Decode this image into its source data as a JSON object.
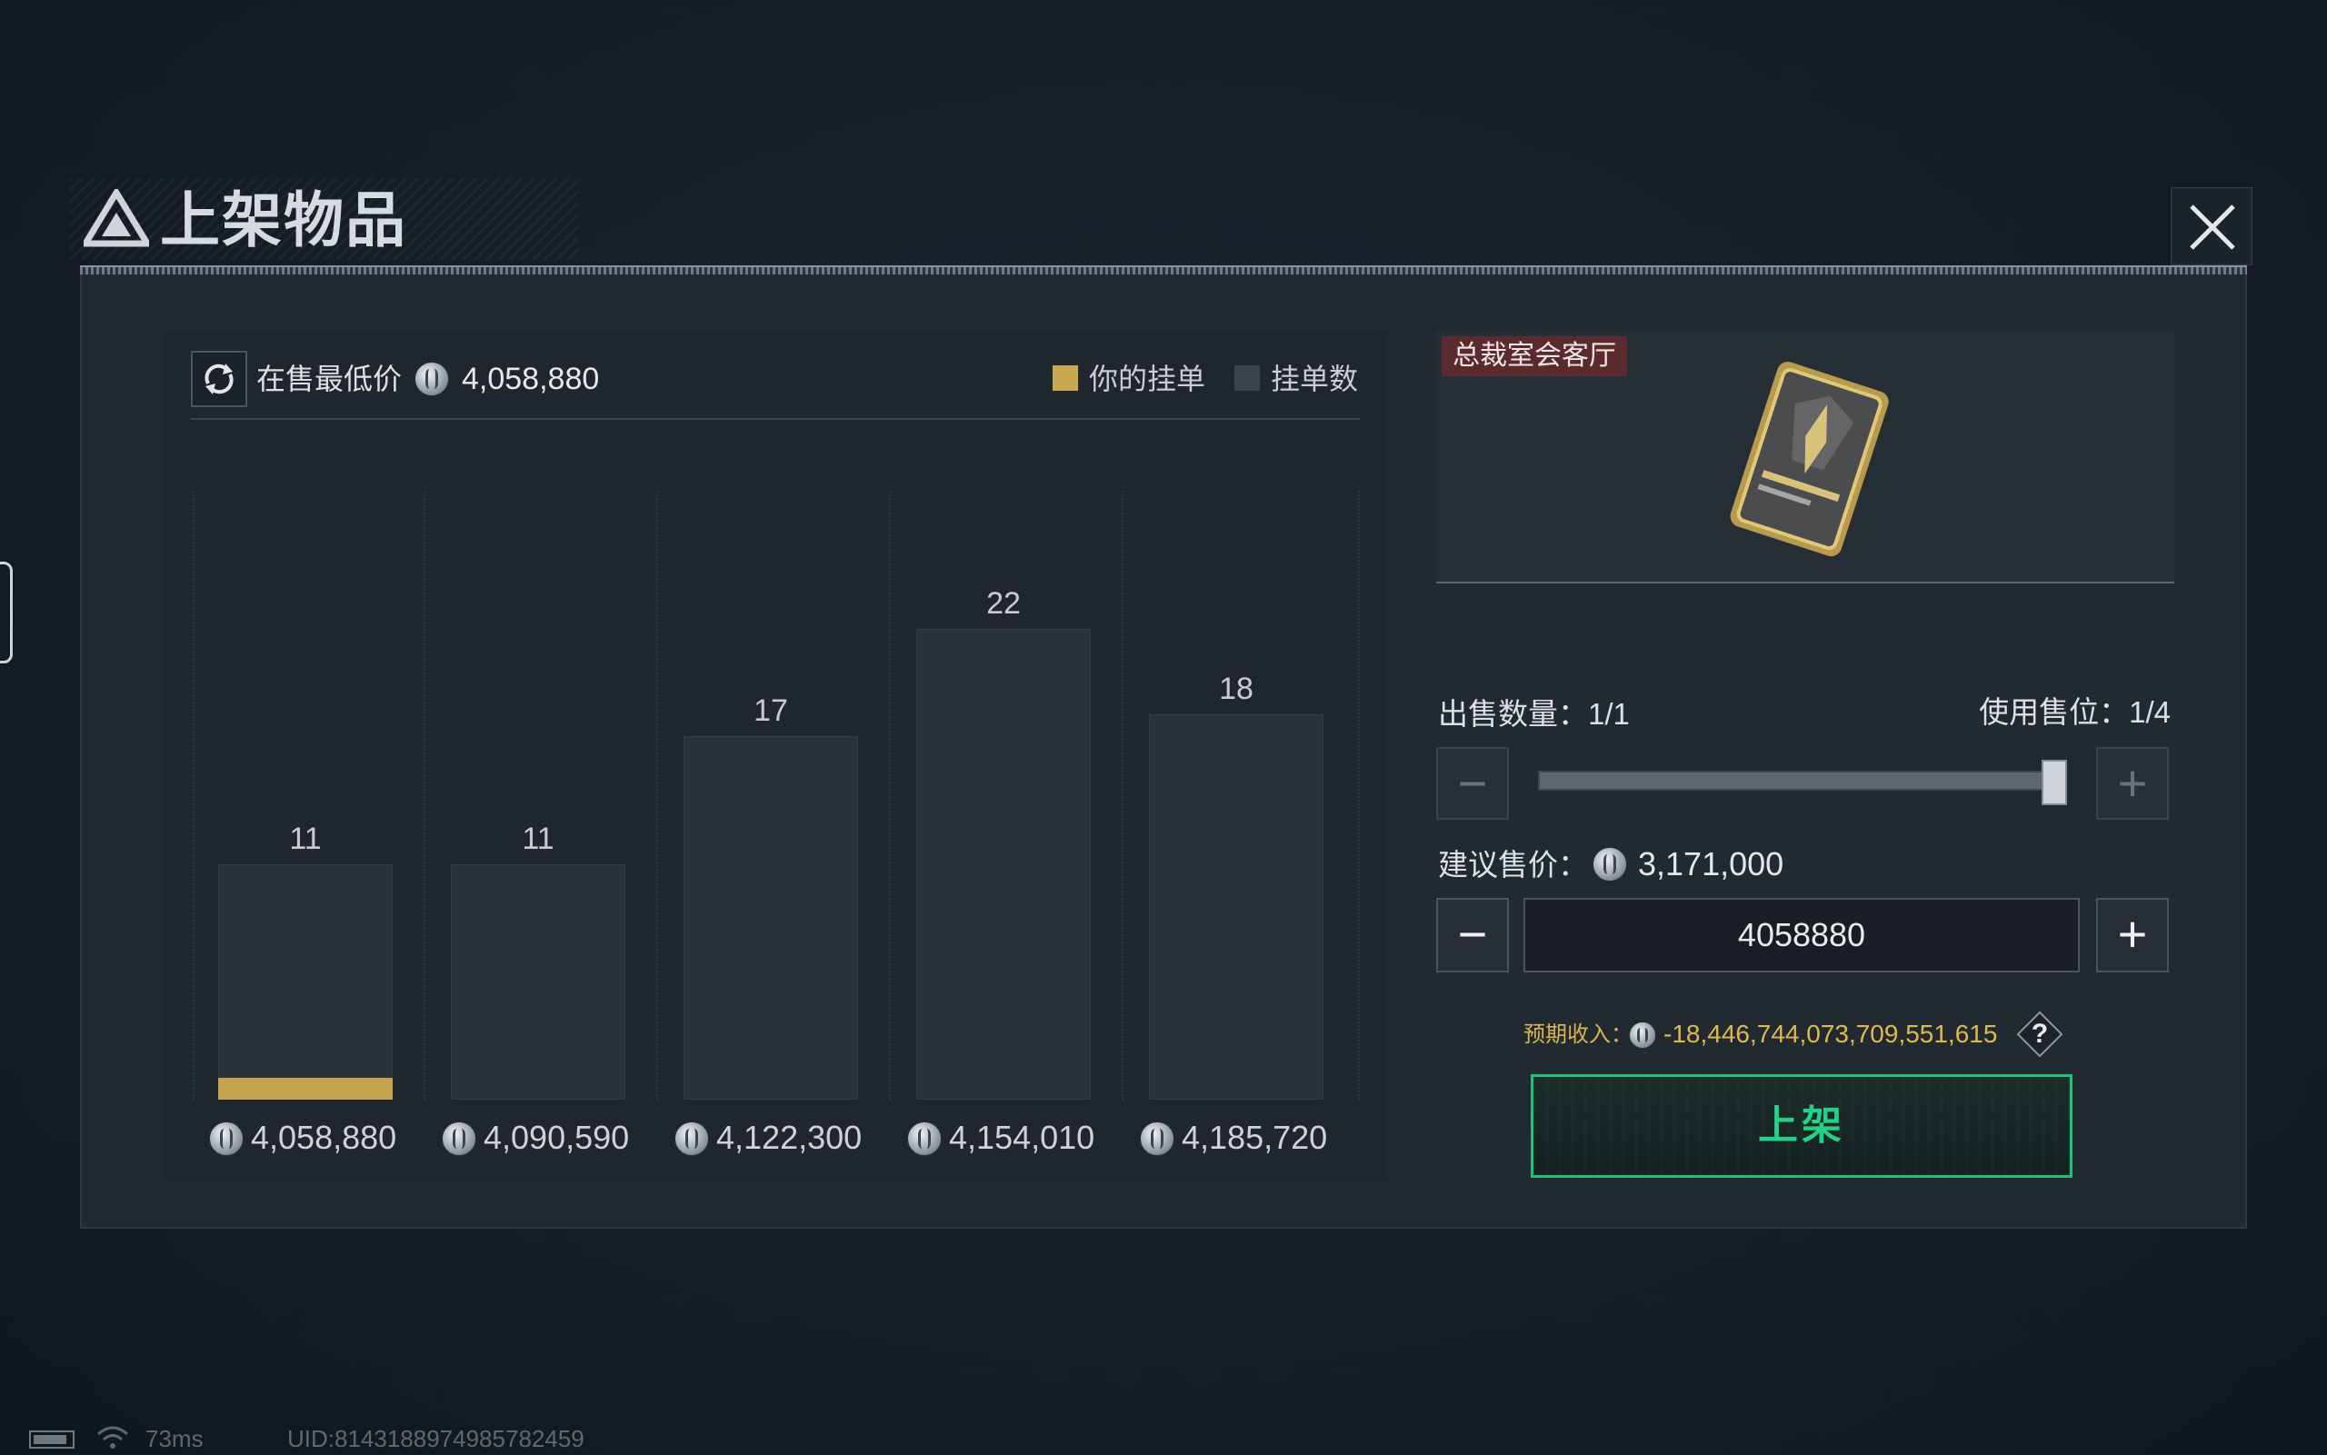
{
  "dialog": {
    "title": "上架物品",
    "close_icon": "close-icon"
  },
  "market": {
    "lowest_label": "在售最低价",
    "lowest_value": "4,058,880",
    "legend": {
      "your_orders": "你的挂单",
      "order_count": "挂单数"
    },
    "colors": {
      "your_orders": "#c8aa55",
      "order_count": "#3c444c"
    }
  },
  "chart_data": {
    "type": "bar",
    "categories": [
      "4,058,880",
      "4,090,590",
      "4,122,300",
      "4,154,010",
      "4,185,720"
    ],
    "series": [
      {
        "name": "挂单数",
        "values": [
          11,
          11,
          17,
          22,
          18
        ]
      },
      {
        "name": "你的挂单",
        "values": [
          1,
          0,
          0,
          0,
          0
        ]
      }
    ],
    "ylim": [
      0,
      26
    ],
    "legend": "top-right",
    "grid": false
  },
  "item": {
    "name": "总裁室会客厅",
    "image_icon": "keycard-icon"
  },
  "sell": {
    "quantity_label": "出售数量：1/1",
    "slot_label": "使用售位：1/4",
    "quantity_fraction": 1.0,
    "suggested_label": "建议售价：",
    "suggested_value": "3,171,000",
    "price_value": "4058880",
    "expected_label": "预期收入：",
    "expected_value": "-18,446,744,073,709,551,615",
    "help": "?",
    "submit_label": "上架"
  },
  "status": {
    "ping": "73ms",
    "uid": "UID:8143188974985782459"
  },
  "accent": "#1ec37a"
}
